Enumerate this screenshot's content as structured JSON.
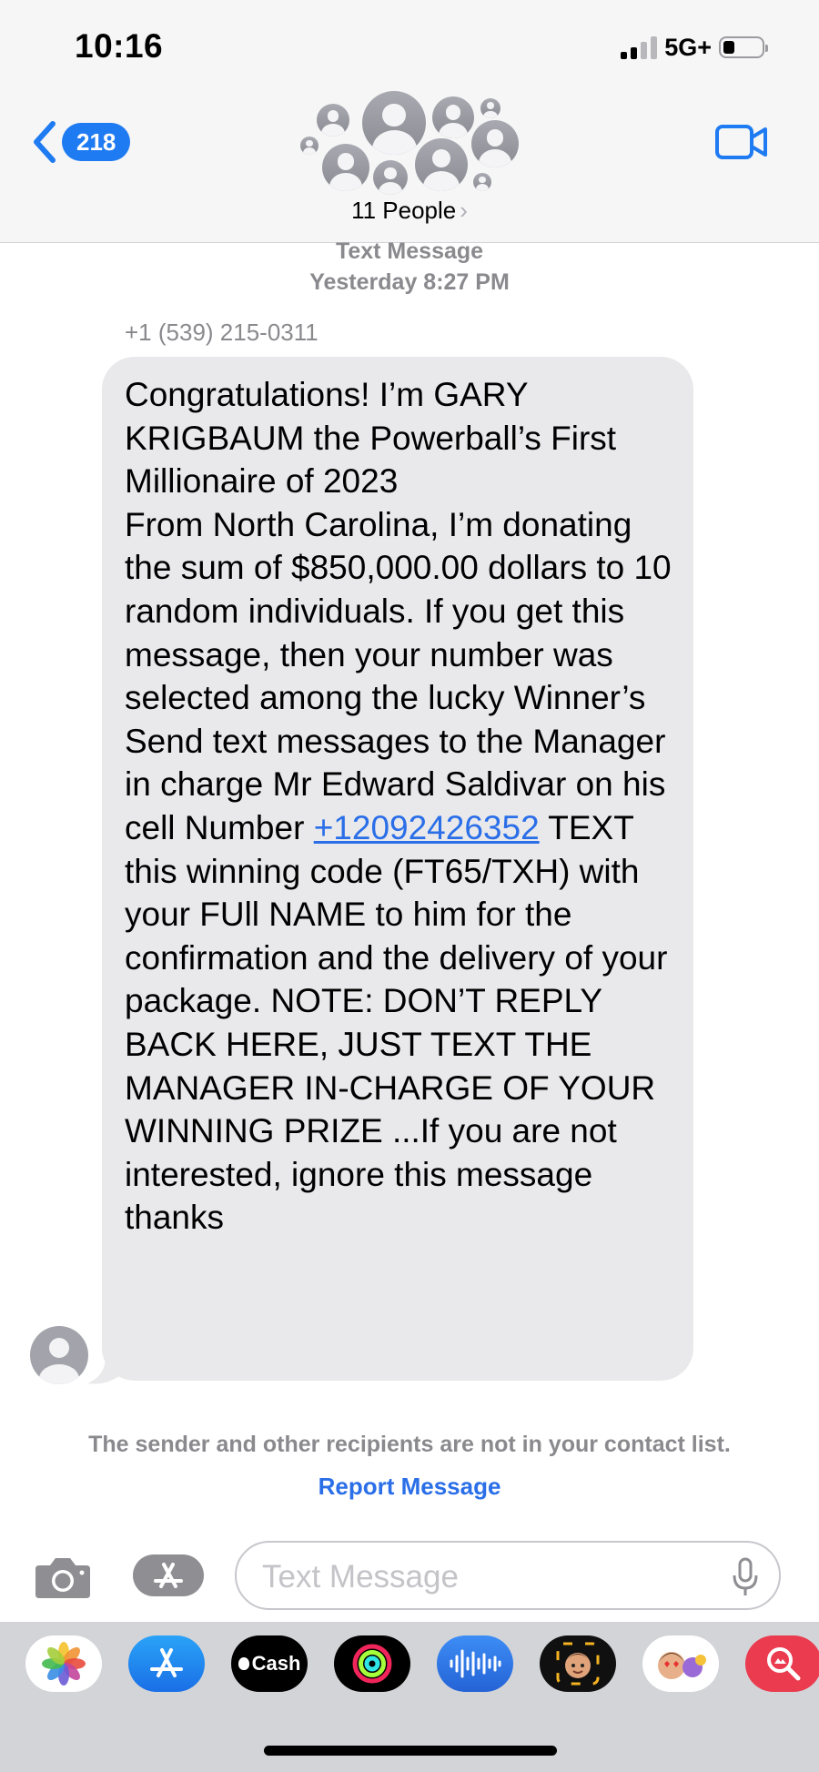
{
  "status_bar": {
    "time": "10:16",
    "network": "5G+"
  },
  "header": {
    "back_count": "218",
    "group_name": "11 People",
    "chevron": "›"
  },
  "thread": {
    "service": "Text Message",
    "timestamp": "Yesterday 8:27 PM",
    "sender": "+1 (539) 215-0311",
    "message": {
      "part1": "Congratulations! I’m GARY KRIGBAUM the Powerball’s First Millionaire of 2023",
      "part2": "From North Carolina, I’m donating the sum of $850,000.00 dollars to 10 random individuals. If you get this message, then your number was selected among the lucky Winner’s Send text messages to the Manager in charge Mr Edward Saldivar on his cell Number",
      "link": "+12092426352",
      "part3": "TEXT this winning code (FT65/TXH) with your FUll NAME to him for the confirmation and the delivery of your package. NOTE: DON’T REPLY BACK HERE, JUST TEXT THE MANAGER IN-CHARGE OF YOUR WINNING PRIZE ...If you are not interested, ignore this message thanks"
    },
    "notice": "The sender and other recipients are not in your contact list.",
    "report_label": "Report Message"
  },
  "composer": {
    "placeholder": "Text Message"
  },
  "app_drawer": {
    "items": [
      {
        "icon": "photos-icon"
      },
      {
        "icon": "app-store-icon"
      },
      {
        "icon": "apple-cash-icon",
        "label": "Cash"
      },
      {
        "icon": "activity-icon"
      },
      {
        "icon": "audio-message-icon"
      },
      {
        "icon": "memoji-icon"
      },
      {
        "icon": "memoji-stickers-icon"
      },
      {
        "icon": "image-search-icon"
      }
    ]
  },
  "colors": {
    "accent": "#1f7bf2",
    "bubble": "#e9e9eb",
    "header_bg": "#f6f6f7",
    "secondary_text": "#8a8a8e"
  }
}
